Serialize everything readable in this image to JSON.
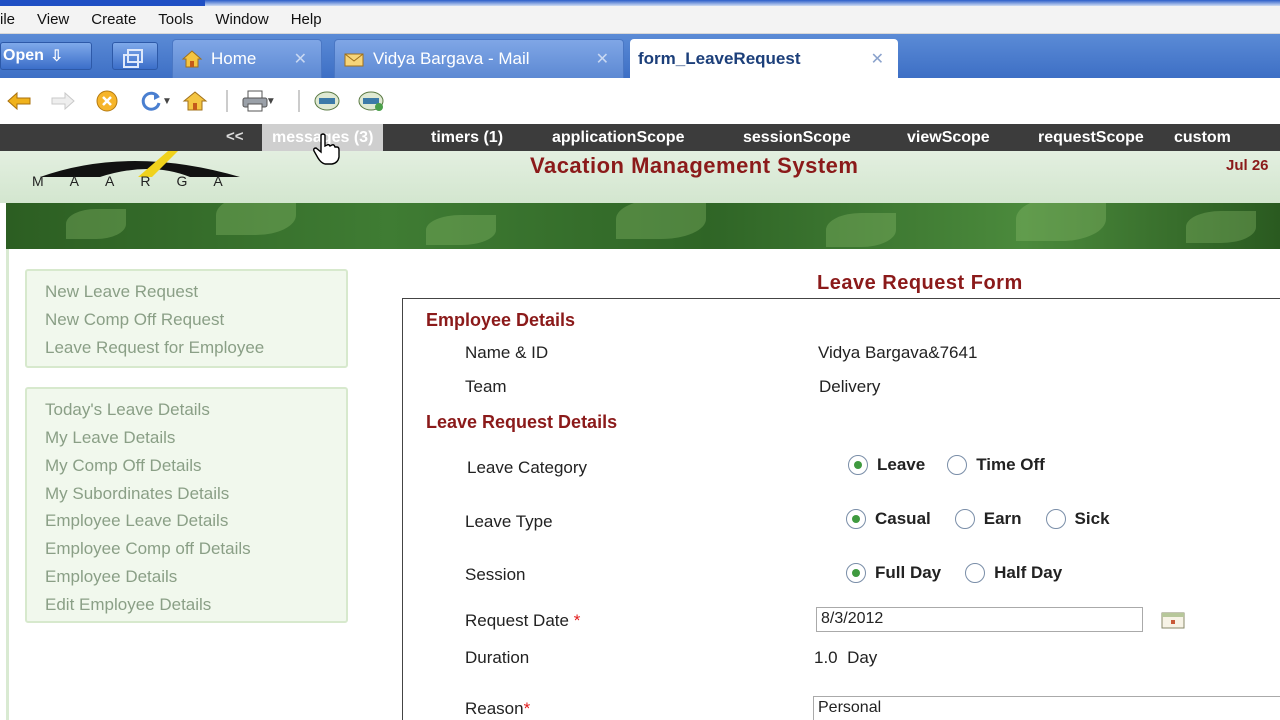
{
  "menubar": {
    "items": [
      "ile",
      "View",
      "Create",
      "Tools",
      "Window",
      "Help"
    ]
  },
  "tabbar": {
    "open_label": "Open",
    "tabs": [
      {
        "label": "Home",
        "icon": "home-icon"
      },
      {
        "label": "Vidya Bargava - Mail",
        "icon": "mail-icon"
      },
      {
        "label": "form_LeaveRequest",
        "icon": ""
      }
    ],
    "close_glyph": "✕"
  },
  "scopebar": {
    "back": "<<",
    "items": [
      "messages (3)",
      "timers (1)",
      "applicationScope",
      "sessionScope",
      "viewScope",
      "requestScope",
      "custom"
    ]
  },
  "header": {
    "logo_text": "MAARGA",
    "app_title": "Vacation Management System",
    "date": "Jul 26"
  },
  "sidebar": {
    "group1": [
      "New Leave Request",
      "New Comp Off Request",
      "Leave Request for Employee"
    ],
    "group2": [
      "Today's Leave Details",
      "My Leave Details",
      "My Comp Off Details",
      "My Subordinates Details",
      "Employee Leave Details",
      "Employee Comp off Details",
      "Employee Details",
      "Edit Employee Details"
    ]
  },
  "form": {
    "title": "Leave Request Form",
    "employee_section": "Employee Details",
    "name_label": "Name & ID",
    "name_value": "Vidya Bargava&7641",
    "team_label": "Team",
    "team_value": "Delivery",
    "request_section": "Leave Request Details",
    "category_label": "Leave Category",
    "category_options": [
      "Leave",
      "Time Off"
    ],
    "type_label": "Leave Type",
    "type_options": [
      "Casual",
      "Earn",
      "Sick"
    ],
    "session_label": "Session",
    "session_options": [
      "Full Day",
      "Half Day"
    ],
    "date_label": "Request Date",
    "required_mark": "*",
    "date_value": "8/3/2012",
    "duration_label": "Duration",
    "duration_value": "1.0  Day",
    "reason_label": "Reason",
    "reason_value": "Personal"
  },
  "colors": {
    "accent": "#8b1a1a",
    "tabbar": "#3d6fc5",
    "sidebar_bg": "#f1f8ed",
    "radio_on": "#3f9a3f"
  }
}
